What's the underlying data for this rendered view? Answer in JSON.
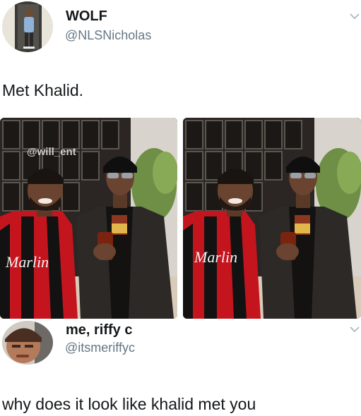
{
  "tweet1": {
    "display_name": "WOLF",
    "handle": "@NLSNicholas",
    "text": "Met Khalid.",
    "watermark": "@will_ent",
    "photo_left_shirt": "Marlin",
    "photo_right_shirt": "Marlin"
  },
  "tweet2": {
    "display_name": "me, riffy c",
    "handle": "@itsmeriffyc",
    "text": "why does it look like khalid met you"
  },
  "icons": {
    "menu": "chevron-down-icon"
  },
  "colors": {
    "text": "#14171a",
    "handle": "#657786",
    "jersey_red": "#d21f2b",
    "jersey_black": "#141414"
  }
}
